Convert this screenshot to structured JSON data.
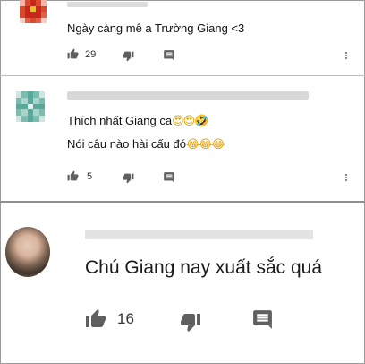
{
  "comments": [
    {
      "text": "Ngày càng mê a Trường Giang <3",
      "likes": "29"
    },
    {
      "lines": [
        {
          "text": "Thích nhất Giang ca",
          "emoji": "😍😍🤣"
        },
        {
          "text": "Nói câu nào hài cấu đó",
          "emoji": "😂😂😂"
        }
      ],
      "likes": "5"
    },
    {
      "text": "Chú Giang nay xuất sắc quá",
      "likes": "16"
    }
  ],
  "icons": {
    "like": "thumb-up-icon",
    "dislike": "thumb-down-icon",
    "reply": "comment-icon",
    "more": "more-vert-icon"
  },
  "colors": {
    "icon": "#606060",
    "avatar1": "#d93a22",
    "avatar2": "#5aa899"
  }
}
